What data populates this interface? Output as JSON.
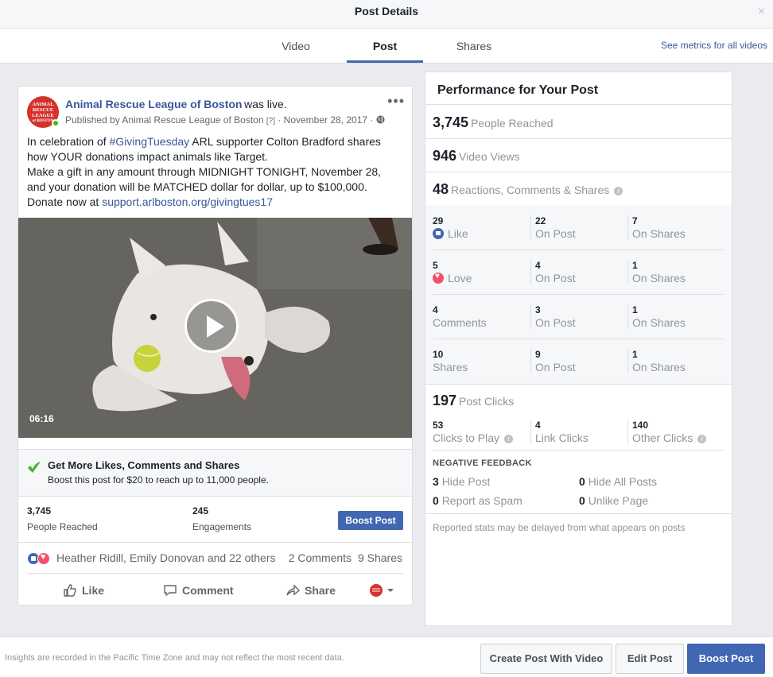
{
  "dialog": {
    "title": "Post Details",
    "close_glyph": "×"
  },
  "tabs": [
    {
      "label": "Video"
    },
    {
      "label": "Post"
    },
    {
      "label": "Shares"
    }
  ],
  "metrics_link": "See metrics for all videos",
  "post": {
    "avatar_text": [
      "ANIMAL",
      "RESCUE",
      "LEAGUE",
      "of BOSTON"
    ],
    "page_name": "Animal Rescue League of Boston",
    "was_live": "was live.",
    "published_prefix": "Published by",
    "published_by": "Animal Rescue League of Boston",
    "help": "[?]",
    "date": "November 28, 2017",
    "text_1": "In celebration of",
    "hashtag": "#GivingTuesday",
    "text_2": "ARL supporter Colton Bradford shares how YOUR donations impact animals like Target.",
    "text_3": "Make a gift in any amount through MIDNIGHT TONIGHT, November 28, and your donation will be MATCHED dollar for dollar, up to $100,000.",
    "text_4": "Donate now at",
    "url": "support.arlboston.org/givingtues17",
    "video_duration": "06:16",
    "boost_head": "Get More Likes, Comments and Shares",
    "boost_sub": "Boost this post for $20 to reach up to 11,000 people.",
    "reached_num": "3,745",
    "reached_label": "People Reached",
    "engagements_num": "245",
    "engagements_label": "Engagements",
    "boost_button": "Boost Post",
    "reactors": "Heather Ridill, Emily Donovan and 22 others",
    "comments_count": "2 Comments",
    "shares_count": "9 Shares",
    "actions": {
      "like": "Like",
      "comment": "Comment",
      "share": "Share"
    }
  },
  "performance": {
    "title": "Performance for Your Post",
    "people_reached": {
      "num": "3,745",
      "label": "People Reached"
    },
    "video_views": {
      "num": "946",
      "label": "Video Views"
    },
    "rcs": {
      "num": "48",
      "label": "Reactions, Comments & Shares"
    },
    "grid": [
      {
        "total": "29",
        "label": "Like",
        "icon": "like",
        "on_post": "22",
        "on_shares": "7"
      },
      {
        "total": "5",
        "label": "Love",
        "icon": "love",
        "on_post": "4",
        "on_shares": "1"
      },
      {
        "total": "4",
        "label": "Comments",
        "icon": "",
        "on_post": "3",
        "on_shares": "1"
      },
      {
        "total": "10",
        "label": "Shares",
        "icon": "",
        "on_post": "9",
        "on_shares": "1"
      }
    ],
    "on_post_label": "On Post",
    "on_shares_label": "On Shares",
    "post_clicks": {
      "num": "197",
      "label": "Post Clicks"
    },
    "clicks": [
      {
        "num": "53",
        "label": "Clicks to Play"
      },
      {
        "num": "4",
        "label": "Link Clicks"
      },
      {
        "num": "140",
        "label": "Other Clicks"
      }
    ],
    "negative_head": "NEGATIVE FEEDBACK",
    "negative": [
      {
        "num": "3",
        "label": "Hide Post"
      },
      {
        "num": "0",
        "label": "Hide All Posts"
      },
      {
        "num": "0",
        "label": "Report as Spam"
      },
      {
        "num": "0",
        "label": "Unlike Page"
      }
    ],
    "note": "Reported stats may be delayed from what appears on posts"
  },
  "footer": {
    "note": "Insights are recorded in the Pacific Time Zone and may not reflect the most recent data.",
    "create": "Create Post With Video",
    "edit": "Edit Post",
    "boost": "Boost Post"
  },
  "colors": {
    "accent": "#4267b2",
    "link": "#365899",
    "love": "#f25268",
    "live_dot": "#42b72a",
    "brand_red": "#d4322b"
  }
}
